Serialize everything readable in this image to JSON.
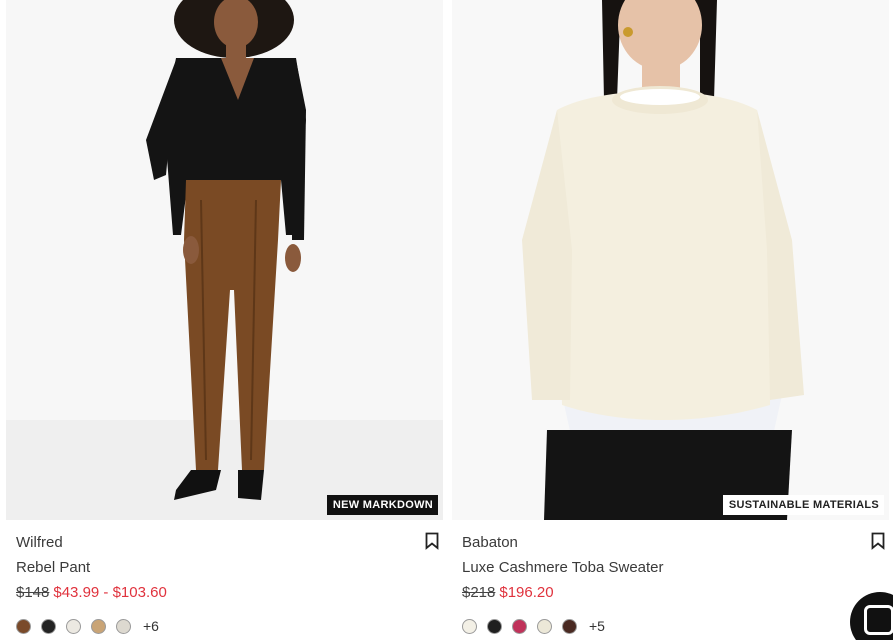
{
  "products": [
    {
      "brand": "Wilfred",
      "name": "Rebel Pant",
      "original_price": "$148",
      "sale_price": "$43.99 - $103.60",
      "badge": "NEW MARKDOWN",
      "swatches": [
        "#7a4a2a",
        "#232323",
        "#ece9e2",
        "#c9a476",
        "#ddd9d0"
      ],
      "more_colors": "+6"
    },
    {
      "brand": "Babaton",
      "name": "Luxe Cashmere Toba Sweater",
      "original_price": "$218",
      "sale_price": "$196.20",
      "badge": "SUSTAINABLE MATERIALS",
      "swatches": [
        "#f3f0e6",
        "#1f1f1f",
        "#c0325a",
        "#ece8d8",
        "#4a2a22"
      ],
      "more_colors": "+5"
    }
  ],
  "icons": {
    "bookmark": "bookmark-icon",
    "chat": "chat-icon"
  },
  "colors": {
    "sale": "#e0323d",
    "badge_dark": "#111111"
  }
}
